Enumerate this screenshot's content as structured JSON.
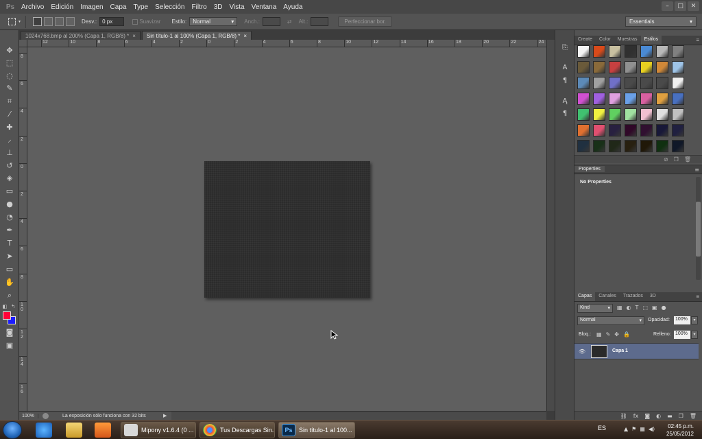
{
  "menu": {
    "logo": "Ps",
    "items": [
      "Archivo",
      "Edición",
      "Imagen",
      "Capa",
      "Type",
      "Selección",
      "Filtro",
      "3D",
      "Vista",
      "Ventana",
      "Ayuda"
    ],
    "window_controls": [
      "–",
      "□",
      "✕"
    ]
  },
  "options": {
    "feather_label": "Desv.:",
    "feather_value": "0 px",
    "antialias_label": "Suavizar",
    "style_label": "Estilo:",
    "style_value": "Normal",
    "width_label": "Anch.:",
    "height_label": "Alt.:",
    "refine_label": "Perfeccionar bor.",
    "workspace": "Essentials"
  },
  "tabs": [
    {
      "label": "1024x768.bmp al 200% (Capa 1, RGB/8) *",
      "close": "×"
    },
    {
      "label": "Sin título-1 al 100% (Capa 1, RGB/8) *",
      "close": "×"
    }
  ],
  "ruler_h": [
    "12",
    "10",
    "8",
    "6",
    "4",
    "2",
    "0",
    "2",
    "4",
    "6",
    "8",
    "10",
    "12",
    "14",
    "16",
    "18",
    "20",
    "22",
    "24"
  ],
  "ruler_v": [
    "8",
    "6",
    "4",
    "2",
    "0",
    "2",
    "4",
    "6",
    "8",
    "1\n0",
    "1\n2",
    "1\n4",
    "1\n6"
  ],
  "status": {
    "zoom": "100%",
    "message": "La exposición sólo funciona con 32 bits",
    "arrow": "▶"
  },
  "panels": {
    "top_tabs": [
      "Create",
      "Color",
      "Muestras",
      "Estilos"
    ],
    "properties_title": "Properties",
    "no_properties": "No Properties",
    "layers_tabs": [
      "Capas",
      "Canales",
      "Trazados",
      "3D"
    ],
    "kind_label": "Kind",
    "blend_mode": "Normal",
    "opacity_label": "Opacidad:",
    "opacity_value": "100%",
    "lock_label": "Bloq.:",
    "fill_label": "Relleno:",
    "fill_value": "100%",
    "layer_name": "Capa 1"
  },
  "style_swatches": [
    "#f4f4f4",
    "#d94a1a",
    "#c8c0a0",
    "#303030",
    "#4a8ad4",
    "#b8b8b8",
    "#808080",
    "#6a5a3a",
    "#8a6a3a",
    "#c84040",
    "#909090",
    "#e8d020",
    "#d08838",
    "#9ec4e8",
    "#5c8ab8",
    "#a0a0a0",
    "#7070c8",
    "#4a4a4a",
    "#4a4a4a",
    "#4a4a4a",
    "#f0f0f0",
    "#d050d0",
    "#a060e0",
    "#e0a0e0",
    "#6aa0e8",
    "#d860a0",
    "#e0a040",
    "#4870c0",
    "#40c070",
    "#f0f040",
    "#60d060",
    "#a0e0a0",
    "#f0c0d0",
    "#e0e0e0",
    "#c0c0c0",
    "#e07030",
    "#e05070",
    "#282040",
    "#300828",
    "#301030",
    "#181838",
    "#202040",
    "#203040",
    "#183018",
    "#202818",
    "#282010",
    "#201808",
    "#103010",
    "#101828"
  ],
  "taskbar": {
    "buttons": [
      "Mipony v1.6.4 (0 ...",
      "Tus Descargas Sin...",
      "Sin título-1 al 100..."
    ],
    "lang": "ES",
    "time": "02:45 p.m.",
    "date": "25/05/2012"
  }
}
